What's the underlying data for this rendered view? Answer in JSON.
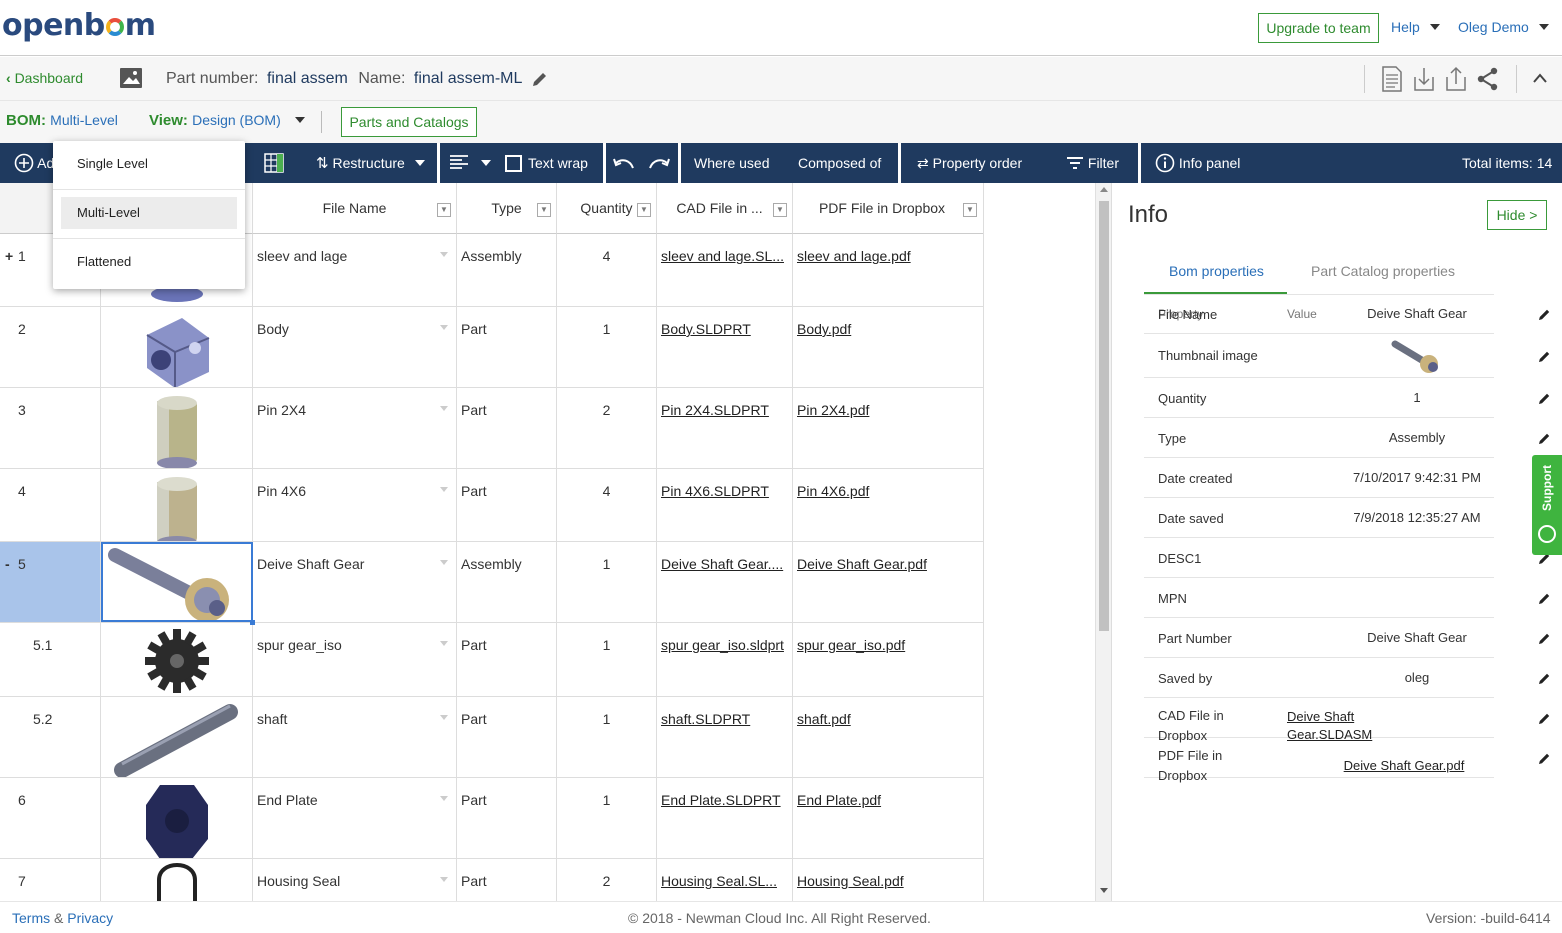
{
  "header": {
    "logo": "openbom",
    "upgrade_label": "Upgrade to team",
    "help_label": "Help",
    "user_label": "Oleg Demo"
  },
  "partbar": {
    "back_label": "Dashboard",
    "part_number_label": "Part number:",
    "part_number_value": "final assem",
    "name_label": "Name:",
    "name_value": "final assem-ML"
  },
  "bombar": {
    "bom_label": "BOM:",
    "bom_value": "Multi-Level",
    "view_label": "View:",
    "view_value": "Design (BOM)",
    "parts_catalogs_label": "Parts and Catalogs"
  },
  "toolbar": {
    "add_label": "Ad",
    "restructure_label": "Restructure",
    "text_wrap_label": "Text wrap",
    "where_used_label": "Where used",
    "composed_of_label": "Composed of",
    "property_order_label": "Property order",
    "filter_label": "Filter",
    "info_panel_label": "Info panel",
    "total_items_label": "Total items: 14"
  },
  "bom_dropdown": {
    "options": [
      "Single Level",
      "Multi-Level",
      "Flattened"
    ],
    "selected": "Multi-Level"
  },
  "grid": {
    "columns": [
      "File Name",
      "Type",
      "Quantity",
      "CAD File in ...",
      "PDF File in Dropbox"
    ],
    "rows": [
      {
        "num": "1",
        "expander": "+",
        "name": "sleev and lage",
        "type": "Assembly",
        "qty": "4",
        "cad": "sleev and lage.SL...",
        "pdf": "sleev and lage.pdf"
      },
      {
        "num": "2",
        "expander": "",
        "name": "Body",
        "type": "Part",
        "qty": "1",
        "cad": "Body.SLDPRT",
        "pdf": "Body.pdf"
      },
      {
        "num": "3",
        "expander": "",
        "name": "Pin 2X4",
        "type": "Part",
        "qty": "2",
        "cad": "Pin 2X4.SLDPRT",
        "pdf": "Pin 2X4.pdf"
      },
      {
        "num": "4",
        "expander": "",
        "name": "Pin 4X6",
        "type": "Part",
        "qty": "4",
        "cad": "Pin 4X6.SLDPRT",
        "pdf": "Pin 4X6.pdf"
      },
      {
        "num": "5",
        "expander": "-",
        "name": "Deive Shaft Gear",
        "type": "Assembly",
        "qty": "1",
        "cad": "Deive Shaft Gear....",
        "pdf": "Deive Shaft Gear.pdf"
      },
      {
        "num": "5.1",
        "expander": "",
        "name": "spur gear_iso",
        "type": "Part",
        "qty": "1",
        "cad": "spur gear_iso.sldprt",
        "pdf": "spur gear_iso.pdf"
      },
      {
        "num": "5.2",
        "expander": "",
        "name": "shaft",
        "type": "Part",
        "qty": "1",
        "cad": "shaft.SLDPRT",
        "pdf": "shaft.pdf"
      },
      {
        "num": "6",
        "expander": "",
        "name": "End Plate",
        "type": "Part",
        "qty": "1",
        "cad": "End Plate.SLDPRT",
        "pdf": "End Plate.pdf"
      },
      {
        "num": "7",
        "expander": "",
        "name": "Housing Seal",
        "type": "Part",
        "qty": "2",
        "cad": "Housing Seal.SL...",
        "pdf": "Housing Seal.pdf"
      }
    ]
  },
  "info": {
    "title": "Info",
    "hide_label": "Hide >",
    "tab_bom": "Bom properties",
    "tab_catalog": "Part Catalog properties",
    "col_property": "Property",
    "col_value": "Value",
    "props": [
      {
        "name": "File Name",
        "value": "Deive Shaft Gear"
      },
      {
        "name": "Thumbnail image",
        "value": ""
      },
      {
        "name": "Quantity",
        "value": "1"
      },
      {
        "name": "Type",
        "value": "Assembly"
      },
      {
        "name": "Date created",
        "value": "7/10/2017 9:42:31 PM"
      },
      {
        "name": "Date saved",
        "value": "7/9/2018 12:35:27 AM"
      },
      {
        "name": "DESC1",
        "value": ""
      },
      {
        "name": "MPN",
        "value": ""
      },
      {
        "name": "Part Number",
        "value": "Deive Shaft Gear"
      },
      {
        "name": "Saved by",
        "value": "oleg"
      },
      {
        "name": "CAD File in Dropbox",
        "value": "Deive Shaft Gear.SLDASM"
      },
      {
        "name": "PDF File in Dropbox",
        "value": "Deive Shaft Gear.pdf"
      }
    ]
  },
  "support_label": "Support",
  "footer": {
    "terms": "Terms",
    "amp": "&",
    "privacy": "Privacy",
    "copyright": "© 2018 - Newman Cloud Inc. All Right Reserved.",
    "version": "Version: -build-6414"
  },
  "colors": {
    "toolbar": "#1f3a5f",
    "accent_green": "#2e8b2e",
    "selected_row": "#a9c4ea",
    "link_blue": "#2a6fb8"
  }
}
